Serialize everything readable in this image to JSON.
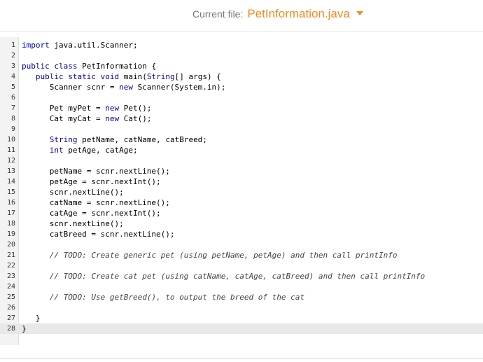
{
  "header": {
    "current_file_label": "Current file:",
    "current_file_name": "PetInformation.java"
  },
  "editor": {
    "active_line": 28,
    "lines": [
      {
        "n": "1",
        "text": "import java.util.Scanner;"
      },
      {
        "n": "2",
        "text": ""
      },
      {
        "n": "3",
        "text": "public class PetInformation {"
      },
      {
        "n": "4",
        "text": "   public static void main(String[] args) {"
      },
      {
        "n": "5",
        "text": "      Scanner scnr = new Scanner(System.in);"
      },
      {
        "n": "6",
        "text": ""
      },
      {
        "n": "7",
        "text": "      Pet myPet = new Pet();"
      },
      {
        "n": "8",
        "text": "      Cat myCat = new Cat();"
      },
      {
        "n": "9",
        "text": ""
      },
      {
        "n": "10",
        "text": "      String petName, catName, catBreed;"
      },
      {
        "n": "11",
        "text": "      int petAge, catAge;"
      },
      {
        "n": "12",
        "text": ""
      },
      {
        "n": "13",
        "text": "      petName = scnr.nextLine();"
      },
      {
        "n": "14",
        "text": "      petAge = scnr.nextInt();"
      },
      {
        "n": "15",
        "text": "      scnr.nextLine();"
      },
      {
        "n": "16",
        "text": "      catName = scnr.nextLine();"
      },
      {
        "n": "17",
        "text": "      catAge = scnr.nextInt();"
      },
      {
        "n": "18",
        "text": "      scnr.nextLine();"
      },
      {
        "n": "19",
        "text": "      catBreed = scnr.nextLine();"
      },
      {
        "n": "20",
        "text": ""
      },
      {
        "n": "21",
        "text": "      // TODO: Create generic pet (using petName, petAge) and then call printInfo"
      },
      {
        "n": "22",
        "text": ""
      },
      {
        "n": "23",
        "text": "      // TODO: Create cat pet (using catName, catAge, catBreed) and then call printInfo"
      },
      {
        "n": "24",
        "text": ""
      },
      {
        "n": "25",
        "text": "      // TODO: Use getBreed(), to output the breed of the cat"
      },
      {
        "n": "26",
        "text": ""
      },
      {
        "n": "27",
        "text": "   }"
      },
      {
        "n": "28",
        "text": "}"
      }
    ]
  }
}
